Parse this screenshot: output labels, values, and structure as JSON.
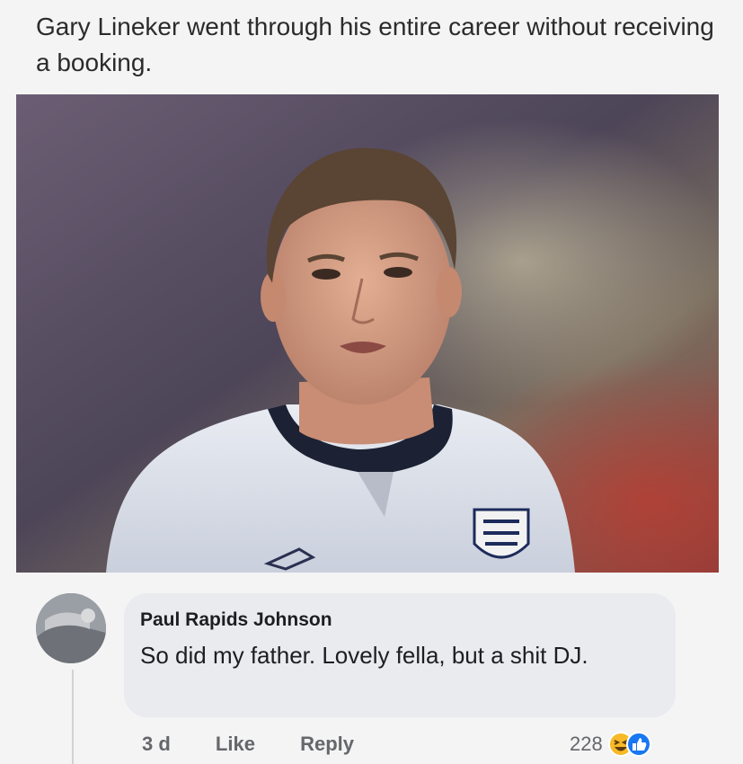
{
  "post": {
    "text": "Gary Lineker went through his entire career without receiving a booking."
  },
  "comment": {
    "author": "Paul Rapids Johnson",
    "text": "So did my father. Lovely fella,  but a shit DJ.",
    "time": "3 d",
    "like_label": "Like",
    "reply_label": "Reply",
    "reaction_count": "228",
    "reaction_icons": [
      "haha-reaction-icon",
      "like-reaction-icon"
    ]
  },
  "colors": {
    "bubble": "#e9ebee",
    "like_blue": "#1877f2",
    "haha_yellow": "#f7b928"
  }
}
